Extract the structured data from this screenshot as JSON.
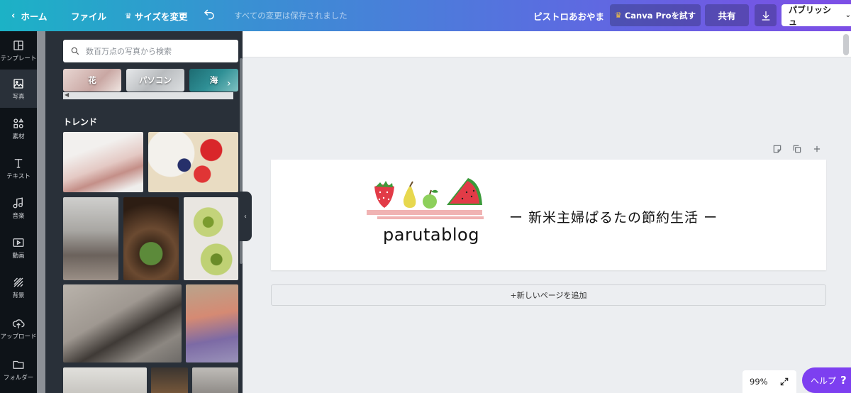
{
  "topbar": {
    "home": "ホーム",
    "file": "ファイル",
    "resize": "サイズを変更",
    "saved_status": "すべての変更は保存されました",
    "user": "ピストロあおやま",
    "pro": "Canva Proを試す",
    "share": "共有",
    "publish": "パブリッシュ"
  },
  "rail": {
    "items": [
      {
        "label": "テンプレート",
        "icon": "template-icon"
      },
      {
        "label": "写真",
        "icon": "photo-icon"
      },
      {
        "label": "素材",
        "icon": "elements-icon"
      },
      {
        "label": "テキスト",
        "icon": "text-icon"
      },
      {
        "label": "音楽",
        "icon": "music-icon"
      },
      {
        "label": "動画",
        "icon": "video-icon"
      },
      {
        "label": "背景",
        "icon": "background-icon"
      },
      {
        "label": "アップロード",
        "icon": "upload-icon"
      },
      {
        "label": "フォルダー",
        "icon": "folder-icon"
      }
    ]
  },
  "panel": {
    "search_placeholder": "数百万点の写真から検索",
    "chips": [
      "花",
      "パソコン",
      "海"
    ],
    "trend_title": "トレンド"
  },
  "design": {
    "logo_text": "parutablog",
    "tagline": "ー 新米主婦ぱるたの節約生活 ー"
  },
  "canvas": {
    "add_page": "+新しいページを追加",
    "zoom": "99%",
    "help": "ヘルプ",
    "help_mark": "?"
  },
  "colors": {
    "rail_bg": "#0e1318",
    "panel_bg": "#293039",
    "help_bg": "#7d3ff0",
    "logo_pink": "#f0b3b3"
  }
}
